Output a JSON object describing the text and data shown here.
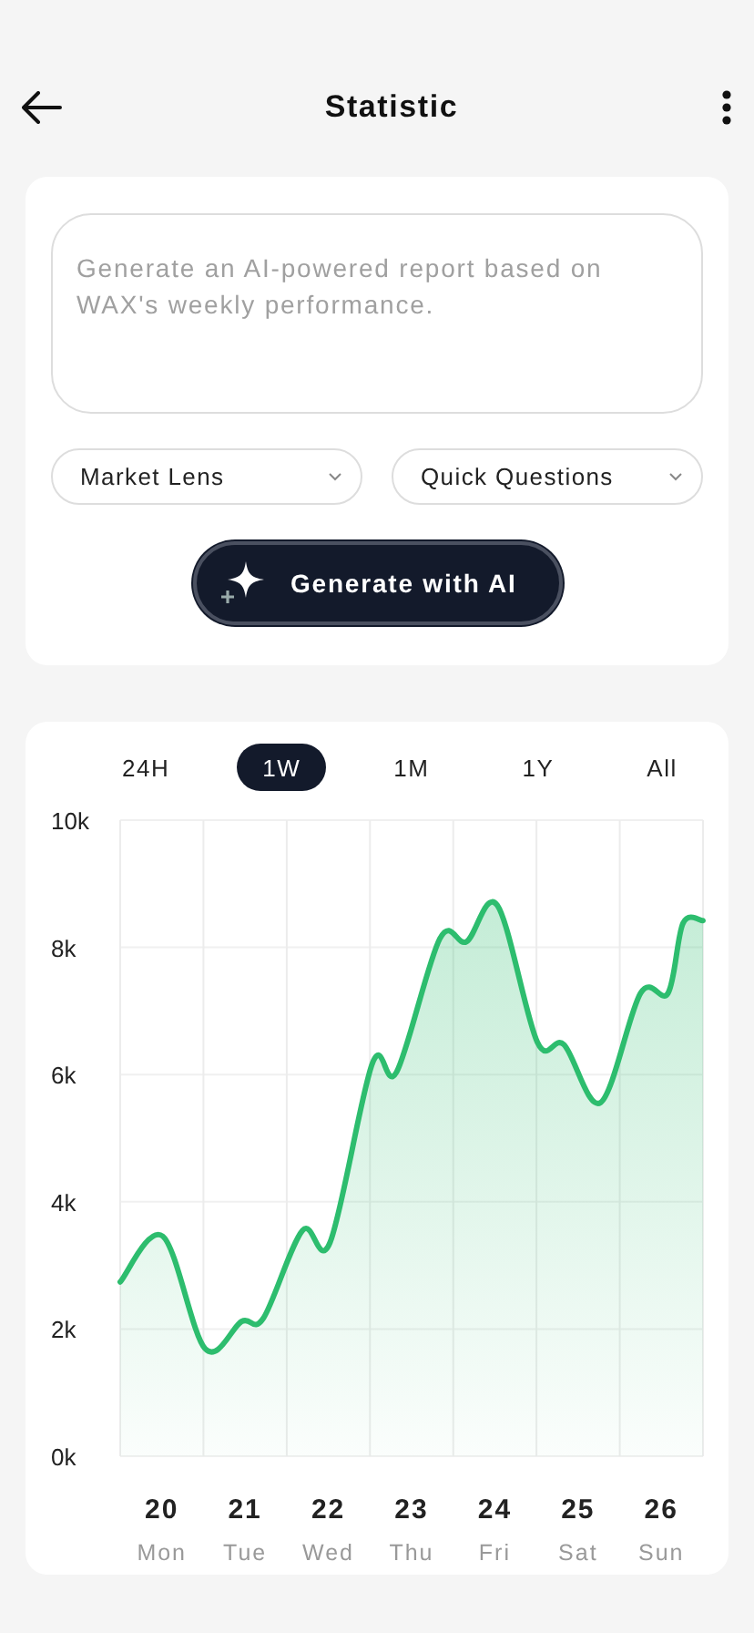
{
  "header": {
    "title": "Statistic"
  },
  "report": {
    "prompt": {
      "placeholder": "Generate an AI-powered report based on WAX's weekly performance."
    },
    "dropdowns": [
      {
        "label": "Market Lens"
      },
      {
        "label": "Quick Questions"
      }
    ],
    "generate_button": {
      "label": "Generate with AI"
    }
  },
  "ranges": [
    {
      "label": "24H",
      "selected": false
    },
    {
      "label": "1W",
      "selected": true
    },
    {
      "label": "1M",
      "selected": false
    },
    {
      "label": "1Y",
      "selected": false
    },
    {
      "label": "All",
      "selected": false
    }
  ],
  "chart_data": {
    "type": "area",
    "x": [
      19.5,
      20.01,
      20.52,
      20.96,
      21.22,
      21.69,
      22.02,
      22.53,
      22.82,
      23.34,
      23.66,
      24.03,
      24.51,
      24.83,
      25.27,
      25.75,
      26.08,
      26.26,
      26.5
    ],
    "series": [
      {
        "color": "#2dbd6e",
        "values": [
          2.74,
          3.46,
          1.69,
          2.12,
          2.17,
          3.55,
          3.36,
          6.18,
          6.04,
          8.14,
          8.09,
          8.66,
          6.51,
          6.47,
          5.56,
          7.28,
          7.28,
          8.38,
          8.42
        ]
      }
    ],
    "xlim": [
      19.5,
      26.5
    ],
    "ylim": [
      0,
      10
    ],
    "grid": true,
    "yticks": [
      {
        "value": 0,
        "label": "0k"
      },
      {
        "value": 2,
        "label": "2k"
      },
      {
        "value": 4,
        "label": "4k"
      },
      {
        "value": 6,
        "label": "6k"
      },
      {
        "value": 8,
        "label": "8k"
      },
      {
        "value": 10,
        "label": "10k"
      }
    ],
    "xticks": [
      20,
      21,
      22,
      23,
      24,
      25,
      26
    ]
  },
  "weekdays": [
    "Mon",
    "Tue",
    "Wed",
    "Thu",
    "Fri",
    "Sat",
    "Sun"
  ]
}
